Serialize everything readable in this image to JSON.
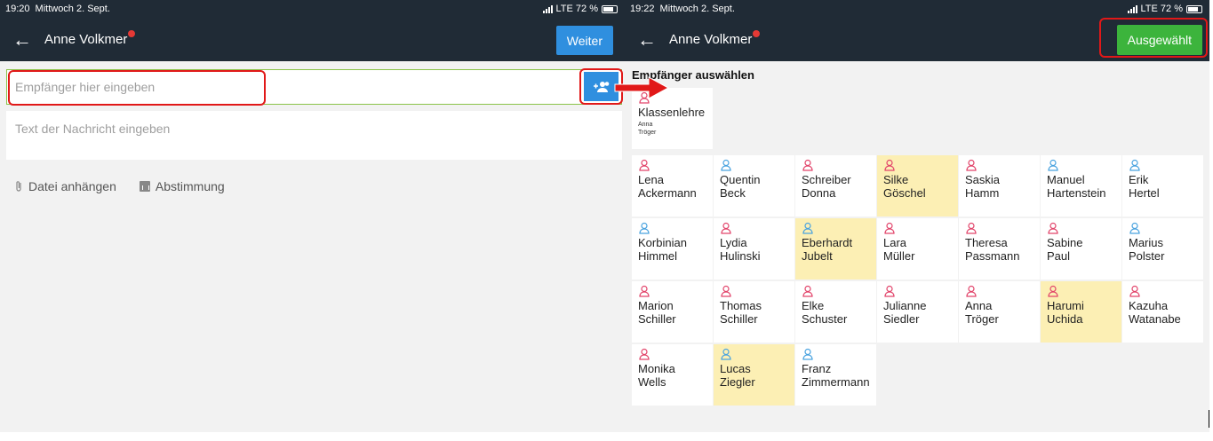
{
  "left": {
    "status": {
      "time": "19:20",
      "date": "Mittwoch 2. Sept.",
      "network": "LTE 72 %"
    },
    "appbar": {
      "back_icon": "arrow-left-icon",
      "title": "Anne Volkmer",
      "weiter_label": "Weiter"
    },
    "recipient": {
      "placeholder": "Empfänger hier eingeben",
      "add_icon": "add-group-icon"
    },
    "message": {
      "placeholder": "Text der Nachricht eingeben"
    },
    "attach": {
      "file_label": "Datei anhängen",
      "poll_label": "Abstimmung"
    }
  },
  "right": {
    "status": {
      "time": "19:22",
      "date": "Mittwoch 2. Sept.",
      "network": "LTE 72 %"
    },
    "appbar": {
      "title": "Anne Volkmer",
      "selected_label": "Ausgewählt"
    },
    "section_title": "Empfänger auswählen",
    "group": {
      "line1": "Klassenlehre",
      "sub1": "Anna",
      "sub2": "Tröger",
      "icon_color": "#e2456b"
    },
    "recipients": [
      {
        "first": "Lena",
        "last": "Ackermann",
        "gender": "f",
        "selected": false
      },
      {
        "first": "Quentin",
        "last": "Beck",
        "gender": "m",
        "selected": false
      },
      {
        "first": "Schreiber",
        "last": "Donna",
        "gender": "f",
        "selected": false
      },
      {
        "first": "Silke",
        "last": "Göschel",
        "gender": "f",
        "selected": true
      },
      {
        "first": "Saskia",
        "last": "Hamm",
        "gender": "f",
        "selected": false
      },
      {
        "first": "Manuel",
        "last": "Hartenstein",
        "gender": "m",
        "selected": false
      },
      {
        "first": "Erik",
        "last": "Hertel",
        "gender": "m",
        "selected": false
      },
      {
        "first": "Korbinian",
        "last": "Himmel",
        "gender": "m",
        "selected": false
      },
      {
        "first": "Lydia",
        "last": "Hulinski",
        "gender": "f",
        "selected": false
      },
      {
        "first": "Eberhardt",
        "last": "Jubelt",
        "gender": "m",
        "selected": true
      },
      {
        "first": "Lara",
        "last": "Müller",
        "gender": "f",
        "selected": false
      },
      {
        "first": "Theresa",
        "last": "Passmann",
        "gender": "f",
        "selected": false
      },
      {
        "first": "Sabine",
        "last": "Paul",
        "gender": "f",
        "selected": false
      },
      {
        "first": "Marius",
        "last": "Polster",
        "gender": "m",
        "selected": false
      },
      {
        "first": "Marion",
        "last": "Schiller",
        "gender": "f",
        "selected": false
      },
      {
        "first": "Thomas",
        "last": "Schiller",
        "gender": "f",
        "selected": false
      },
      {
        "first": "Elke",
        "last": "Schuster",
        "gender": "f",
        "selected": false
      },
      {
        "first": "Julianne",
        "last": "Siedler",
        "gender": "f",
        "selected": false
      },
      {
        "first": "Anna",
        "last": "Tröger",
        "gender": "f",
        "selected": false
      },
      {
        "first": "Harumi",
        "last": "Uchida",
        "gender": "f",
        "selected": true
      },
      {
        "first": "Kazuha",
        "last": "Watanabe",
        "gender": "f",
        "selected": false
      },
      {
        "first": "Monika",
        "last": "Wells",
        "gender": "f",
        "selected": false
      },
      {
        "first": "Lucas",
        "last": "Ziegler",
        "gender": "m",
        "selected": true
      },
      {
        "first": "Franz",
        "last": "Zimmermann",
        "gender": "m",
        "selected": false
      }
    ]
  },
  "colors": {
    "appbar": "#202b36",
    "primary": "#2f8fdf",
    "success": "#3cb43c",
    "highlight": "#e11818",
    "selected_cell": "#fcefb4",
    "female_icon": "#e2456b",
    "male_icon": "#4aa3df"
  }
}
